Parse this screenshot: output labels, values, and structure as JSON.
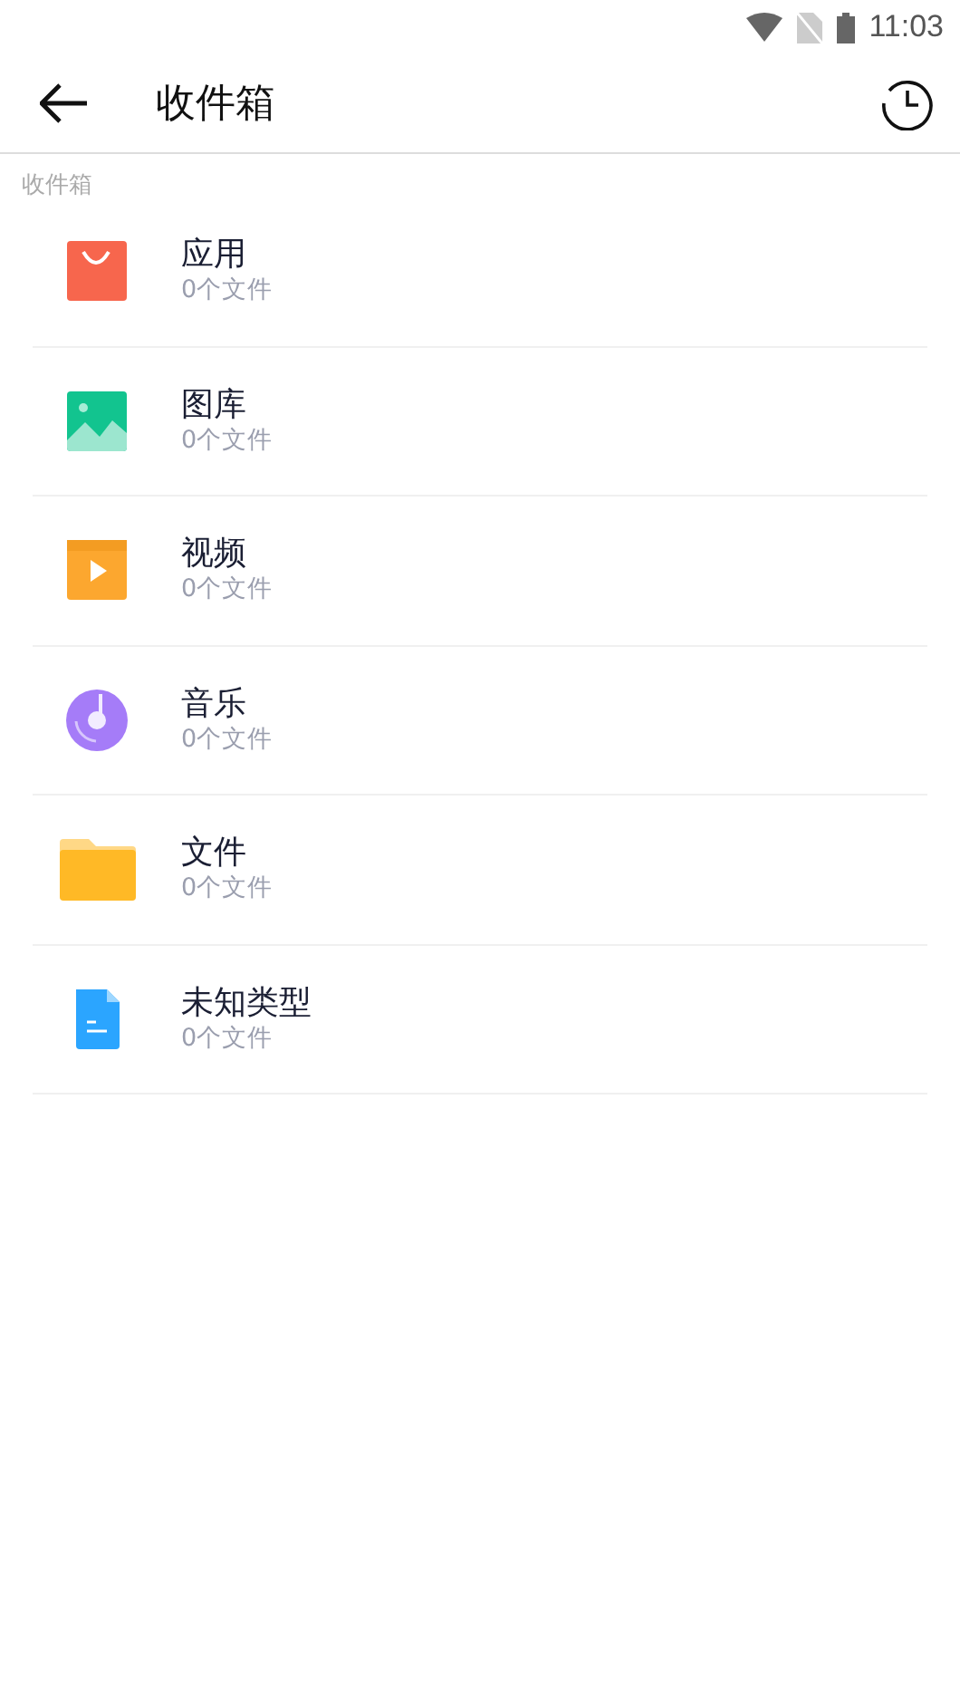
{
  "status_bar": {
    "time": "11:03"
  },
  "app_bar": {
    "title": "收件箱"
  },
  "section": {
    "label": "收件箱"
  },
  "categories": [
    {
      "kind": "apps",
      "name": "应用",
      "count": "0个文件"
    },
    {
      "kind": "gallery",
      "name": "图库",
      "count": "0个文件"
    },
    {
      "kind": "video",
      "name": "视频",
      "count": "0个文件"
    },
    {
      "kind": "music",
      "name": "音乐",
      "count": "0个文件"
    },
    {
      "kind": "files",
      "name": "文件",
      "count": "0个文件"
    },
    {
      "kind": "unknown",
      "name": "未知类型",
      "count": "0个文件"
    }
  ]
}
